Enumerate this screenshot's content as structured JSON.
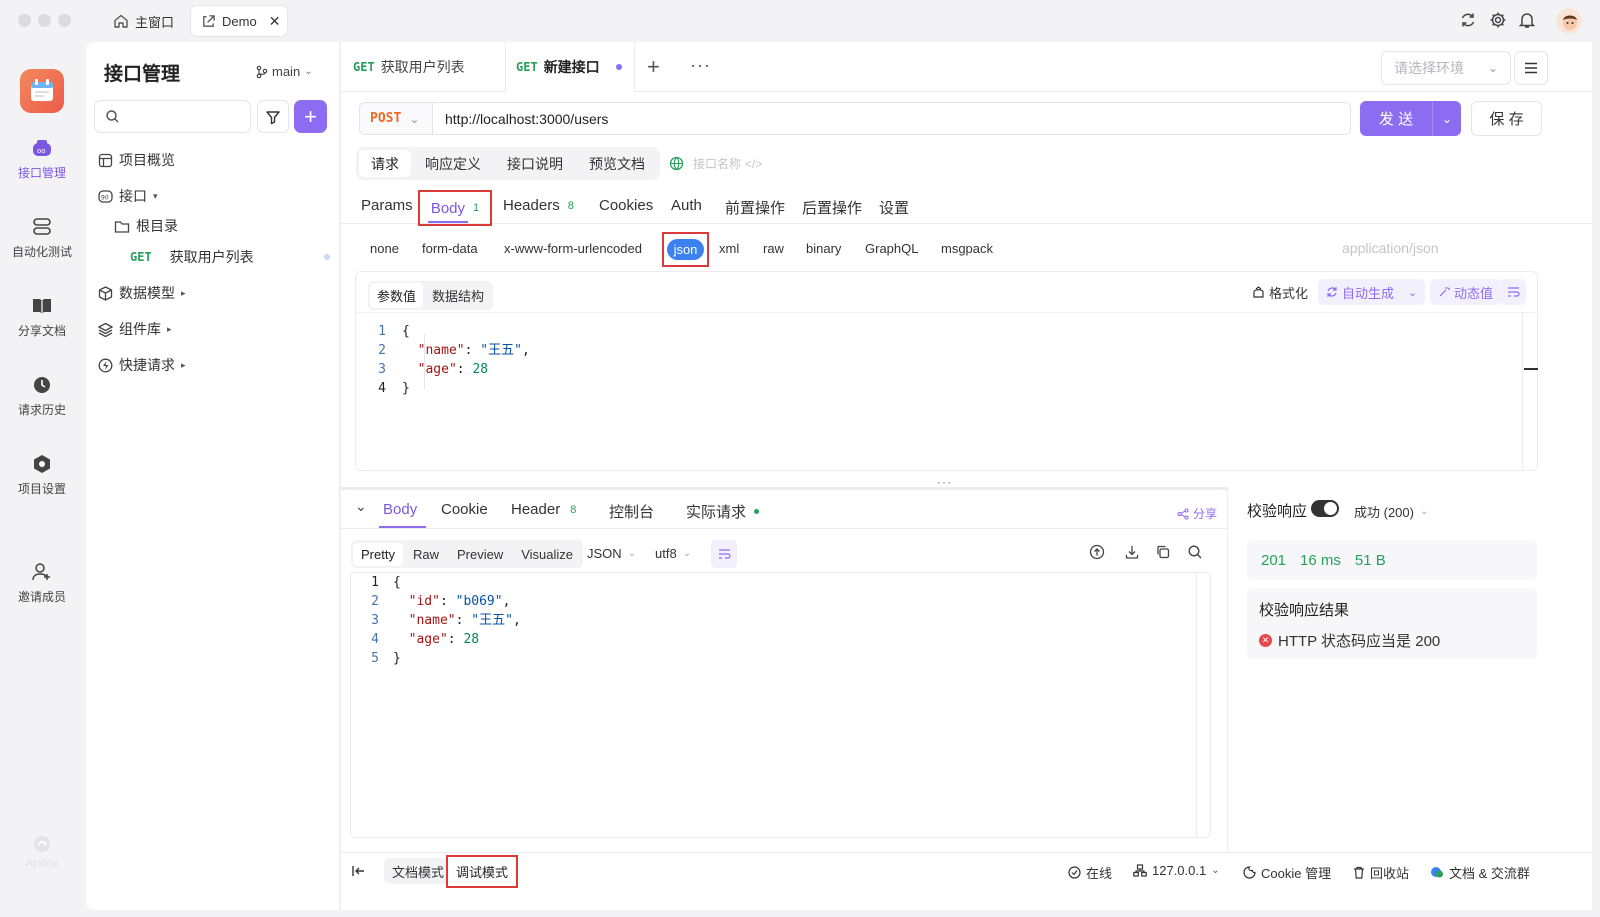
{
  "titlebar": {
    "home_tab": "主窗口",
    "active_tab": "Demo"
  },
  "rail": {
    "brand": "Apifox",
    "items": [
      {
        "label": "接口管理"
      },
      {
        "label": "自动化测试"
      },
      {
        "label": "分享文档"
      },
      {
        "label": "请求历史"
      },
      {
        "label": "项目设置"
      },
      {
        "label": "邀请成员"
      }
    ]
  },
  "tree": {
    "title": "接口管理",
    "branch": "main",
    "search_placeholder": "",
    "items": {
      "overview": "项目概览",
      "api": "接口",
      "root": "根目录",
      "endpoint_method": "GET",
      "endpoint_name": "获取用户列表",
      "models": "数据模型",
      "components": "组件库",
      "quick": "快捷请求"
    }
  },
  "tabs": {
    "tab1_method": "GET",
    "tab1_name": "获取用户列表",
    "tab2_method": "GET",
    "tab2_name": "新建接口",
    "env_placeholder": "请选择环境"
  },
  "request": {
    "method": "POST",
    "url": "http://localhost:3000/users",
    "send_label": "发 送",
    "save_label": "保 存",
    "mode_tabs": [
      "请求",
      "响应定义",
      "接口说明",
      "预览文档"
    ],
    "name_placeholder": "接口名称",
    "param_tabs": {
      "params": "Params",
      "body": "Body",
      "body_count": "1",
      "headers": "Headers",
      "headers_count": "8",
      "cookies": "Cookies",
      "auth": "Auth",
      "pre": "前置操作",
      "post": "后置操作",
      "settings": "设置"
    },
    "body_types": [
      "none",
      "form-data",
      "x-www-form-urlencoded",
      "json",
      "xml",
      "raw",
      "binary",
      "GraphQL",
      "msgpack"
    ],
    "content_type": "application/json",
    "editor_tabs": [
      "参数值",
      "数据结构"
    ],
    "editor_tools": {
      "format": "格式化",
      "autogen": "自动生成",
      "dynamic": "动态值"
    },
    "code_lines": [
      {
        "n": "1",
        "parts": [
          {
            "t": "{",
            "c": ""
          }
        ]
      },
      {
        "n": "2",
        "parts": [
          {
            "t": "  \"name\"",
            "c": "k"
          },
          {
            "t": ": ",
            "c": ""
          },
          {
            "t": "\"王五\"",
            "c": "s"
          },
          {
            "t": ",",
            "c": ""
          }
        ]
      },
      {
        "n": "3",
        "parts": [
          {
            "t": "  \"age\"",
            "c": "k"
          },
          {
            "t": ": ",
            "c": ""
          },
          {
            "t": "28",
            "c": "n"
          }
        ]
      },
      {
        "n": "4",
        "parts": [
          {
            "t": "}",
            "c": ""
          }
        ]
      }
    ]
  },
  "response": {
    "tabs": {
      "body": "Body",
      "cookie": "Cookie",
      "header": "Header",
      "header_count": "8",
      "console": "控制台",
      "actual": "实际请求"
    },
    "share": "分享",
    "view_tabs": [
      "Pretty",
      "Raw",
      "Preview",
      "Visualize"
    ],
    "format": "JSON",
    "encoding": "utf8",
    "code_lines": [
      {
        "n": "1",
        "parts": [
          {
            "t": "{",
            "c": ""
          }
        ]
      },
      {
        "n": "2",
        "parts": [
          {
            "t": "  \"id\"",
            "c": "k"
          },
          {
            "t": ": ",
            "c": ""
          },
          {
            "t": "\"b069\"",
            "c": "s"
          },
          {
            "t": ",",
            "c": ""
          }
        ]
      },
      {
        "n": "3",
        "parts": [
          {
            "t": "  \"name\"",
            "c": "k"
          },
          {
            "t": ": ",
            "c": ""
          },
          {
            "t": "\"王五\"",
            "c": "s"
          },
          {
            "t": ",",
            "c": ""
          }
        ]
      },
      {
        "n": "4",
        "parts": [
          {
            "t": "  \"age\"",
            "c": "k"
          },
          {
            "t": ": ",
            "c": ""
          },
          {
            "t": "28",
            "c": "n"
          }
        ]
      },
      {
        "n": "5",
        "parts": [
          {
            "t": "}",
            "c": ""
          }
        ]
      }
    ]
  },
  "validation": {
    "title": "校验响应",
    "status_select": "成功 (200)",
    "status_code": "201",
    "time": "16 ms",
    "size": "51 B",
    "result_title": "校验响应结果",
    "result_msg": "HTTP 状态码应当是 200"
  },
  "statusbar": {
    "doc_mode": "文档模式",
    "debug_mode": "调试模式",
    "online": "在线",
    "host": "127.0.0.1",
    "cookie": "Cookie 管理",
    "trash": "回收站",
    "docs": "文档 & 交流群"
  },
  "colors": {
    "accent": "#8c6cf0",
    "get": "#27a05b",
    "post": "#e86a25",
    "error": "#e5484d"
  }
}
